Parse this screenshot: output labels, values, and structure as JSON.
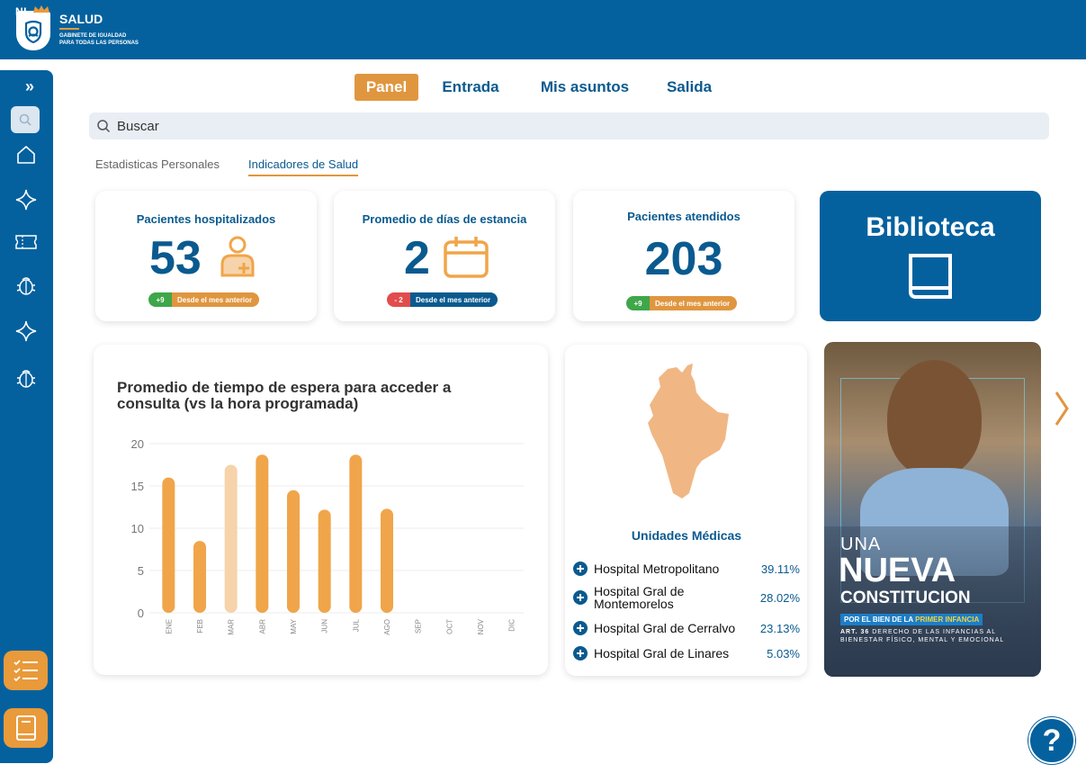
{
  "header": {
    "logo_text": "NL",
    "title": "SALUD",
    "subtitle_line1": "GABINETE DE IGUALDAD",
    "subtitle_line2": "PARA TODAS LAS PERSONAS"
  },
  "sidebar": {
    "expand_icon": "chevrons-right-icon",
    "items": [
      {
        "icon": "search-icon"
      },
      {
        "icon": "home-icon"
      },
      {
        "icon": "sparkle-icon"
      },
      {
        "icon": "ticket-icon"
      },
      {
        "icon": "bug-icon"
      },
      {
        "icon": "sparkle-icon"
      },
      {
        "icon": "bug-icon"
      }
    ],
    "bottom_items": [
      {
        "icon": "checklist-icon"
      },
      {
        "icon": "book-icon"
      }
    ]
  },
  "tabs": [
    {
      "label": "Panel",
      "active": true
    },
    {
      "label": "Entrada",
      "active": false
    },
    {
      "label": "Mis asuntos",
      "active": false
    },
    {
      "label": "Salida",
      "active": false
    }
  ],
  "search": {
    "placeholder": "Buscar"
  },
  "subtabs": [
    {
      "label": "Estadisticas Personales",
      "active": false
    },
    {
      "label": "Indicadores de Salud",
      "active": true
    }
  ],
  "kpis": [
    {
      "title": "Pacientes hospitalizados",
      "value": "53",
      "icon": "patient-plus-icon",
      "delta": "+9",
      "delta_label": "Desde el mes anterior",
      "delta_color": "#3fa64a",
      "label_color": "#e0963f"
    },
    {
      "title": "Promedio de días de estancia",
      "value": "2",
      "icon": "calendar-icon",
      "delta": "- 2",
      "delta_label": "Desde el mes anterior",
      "delta_color": "#e24c4c",
      "label_color": "#0a5a8f"
    },
    {
      "title": "Pacientes atendidos",
      "value": "203",
      "icon": "",
      "delta": "+9",
      "delta_label": "Desde el mes anterior",
      "delta_color": "#3fa64a",
      "label_color": "#e0963f"
    }
  ],
  "biblioteca": {
    "title": "Biblioteca",
    "icon": "book-icon"
  },
  "chart_data": {
    "type": "bar",
    "title": "Promedio de tiempo de espera para acceder a consulta (vs la hora programada)",
    "categories": [
      "ENE",
      "FEB",
      "MAR",
      "ABR",
      "MAY",
      "JUN",
      "JUL",
      "AGO",
      "SEP",
      "OCT",
      "NOV",
      "DIC"
    ],
    "values": [
      16,
      8.5,
      17.5,
      18.7,
      14.5,
      12.2,
      18.7,
      12.3,
      null,
      null,
      null,
      null
    ],
    "highlight_index": 2,
    "ylim": [
      0,
      20
    ],
    "yticks": [
      "0",
      "5",
      "10",
      "15",
      "20"
    ],
    "bar_color": "#f0a54a",
    "highlight_color": "#f6d3aa",
    "grid": true
  },
  "unidades": {
    "title": "Unidades Médicas",
    "hospitals": [
      {
        "name": "Hospital Metropolitano",
        "pct": "39.11%"
      },
      {
        "name": "Hospital Gral de Montemorelos",
        "pct": "28.02%"
      },
      {
        "name": "Hospital Gral de Cerralvo",
        "pct": "23.13%"
      },
      {
        "name": "Hospital Gral de Linares",
        "pct": "5.03%"
      }
    ]
  },
  "poster": {
    "line1": "UNA",
    "line2": "NUEVA",
    "line3": "CONSTITUCION",
    "ribbon_prefix": "POR EL BIEN DE LA",
    "ribbon_highlight": "PRIMER INFANCIA",
    "footer_bold": "ART. 36",
    "footer_text": "DERECHO DE LAS INFANCIAS AL BIENESTAR FÍSICO, MENTAL Y EMOCIONAL"
  },
  "help": {
    "label": "?"
  }
}
